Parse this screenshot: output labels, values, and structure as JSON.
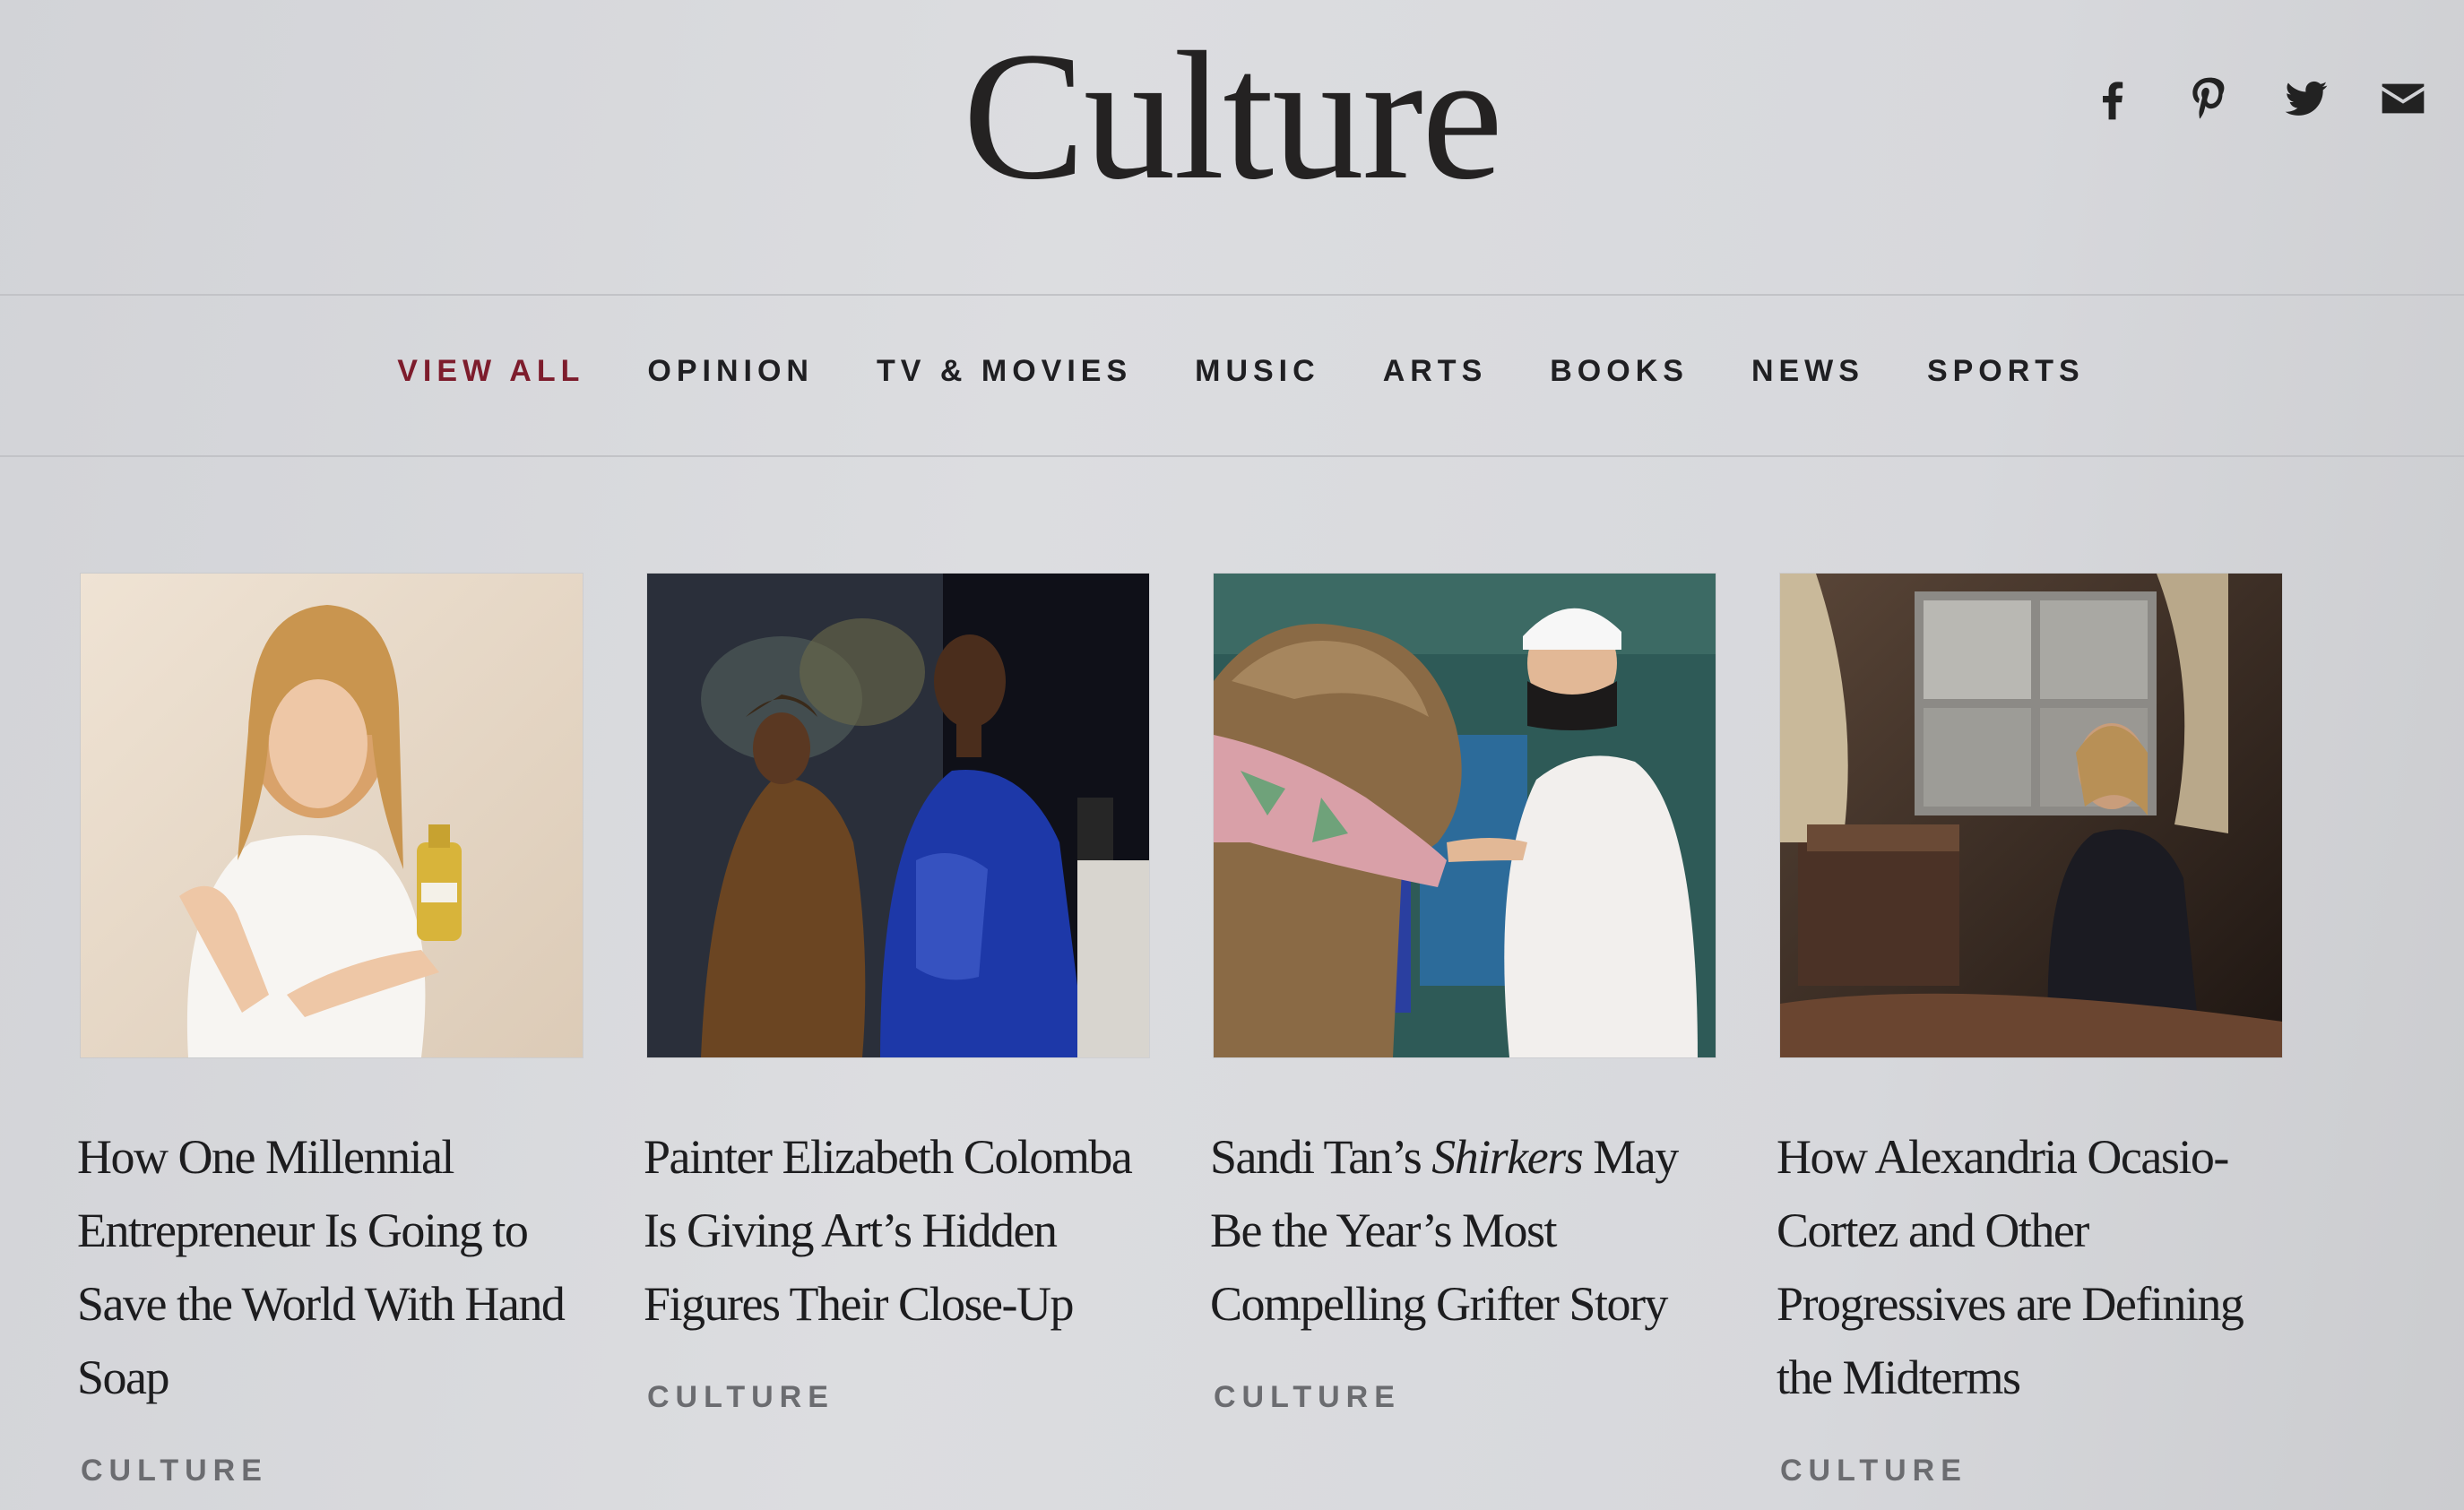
{
  "header": {
    "title": "Culture",
    "social": [
      {
        "name": "facebook-icon",
        "label": "Facebook"
      },
      {
        "name": "pinterest-icon",
        "label": "Pinterest"
      },
      {
        "name": "twitter-icon",
        "label": "Twitter"
      },
      {
        "name": "email-icon",
        "label": "Email"
      }
    ]
  },
  "nav": {
    "items": [
      {
        "label": "VIEW ALL",
        "active": true
      },
      {
        "label": "OPINION",
        "active": false
      },
      {
        "label": "TV & MOVIES",
        "active": false
      },
      {
        "label": "MUSIC",
        "active": false
      },
      {
        "label": "ARTS",
        "active": false
      },
      {
        "label": "BOOKS",
        "active": false
      },
      {
        "label": "NEWS",
        "active": false
      },
      {
        "label": "SPORTS",
        "active": false
      }
    ],
    "active_color": "#7d1c2c"
  },
  "articles": [
    {
      "headline_before": "How One Millennial Entrepreneur Is Going to Save the World With Hand Soap",
      "headline_italic": "",
      "headline_after": "",
      "kicker": "CULTURE",
      "image": "woman-with-soap-bottle"
    },
    {
      "headline_before": "Painter Elizabeth Colomba Is Giving Art’s Hidden Figures Their Close-Up",
      "headline_italic": "",
      "headline_after": "",
      "kicker": "CULTURE",
      "image": "painting-of-two-women"
    },
    {
      "headline_before": "Sandi Tan’s ",
      "headline_italic": "Shirkers",
      "headline_after": " May Be the Year’s Most Compelling Grifter Story",
      "kicker": "CULTURE",
      "image": "nurse-with-dog"
    },
    {
      "headline_before": "How Alexandria Ocasio-Cortez and Other Progressives are Defining the Midterms",
      "headline_italic": "",
      "headline_after": "",
      "kicker": "CULTURE",
      "image": "woman-sitting-in-room"
    }
  ]
}
